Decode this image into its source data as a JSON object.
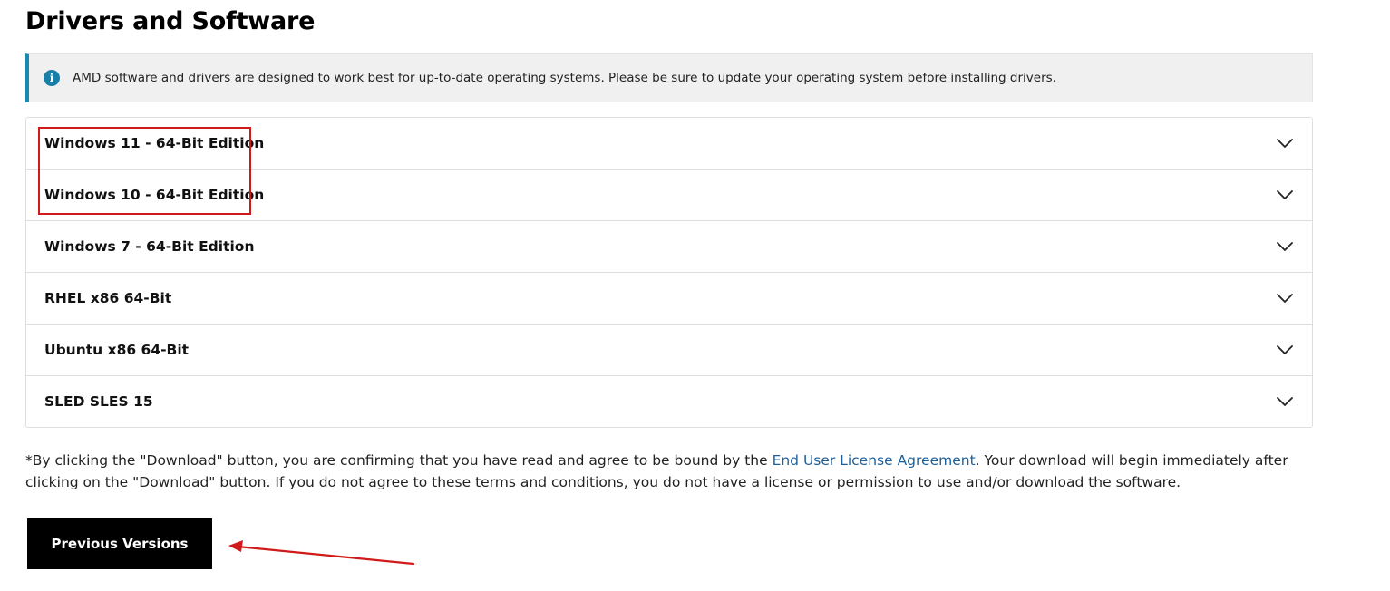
{
  "page": {
    "title": "Drivers and Software"
  },
  "notice": {
    "icon": "info-icon",
    "icon_glyph": "i",
    "text": "AMD software and drivers are designed to work best for up-to-date operating systems. Please be sure to update your operating system before installing drivers."
  },
  "accordion": {
    "items": [
      {
        "label": "Windows 11 - 64-Bit Edition",
        "icon": "chevron-down-icon"
      },
      {
        "label": "Windows 10 - 64-Bit Edition",
        "icon": "chevron-down-icon"
      },
      {
        "label": "Windows 7 - 64-Bit Edition",
        "icon": "chevron-down-icon"
      },
      {
        "label": "RHEL x86 64-Bit",
        "icon": "chevron-down-icon"
      },
      {
        "label": "Ubuntu x86 64-Bit",
        "icon": "chevron-down-icon"
      },
      {
        "label": "SLED SLES 15",
        "icon": "chevron-down-icon"
      }
    ]
  },
  "disclaimer": {
    "before_link": "*By clicking the \"Download\" button, you are confirming that you have read and agree to be bound by the ",
    "link_text": "End User License Agreement",
    "after_link": ". Your download will begin immediately after clicking on the \"Download\" button. If you do not agree to these terms and conditions, you do not have a license or permission to use and/or download the software."
  },
  "previous_versions": {
    "label": "Previous Versions"
  },
  "annotations": {
    "color": "#d11a1a",
    "highlight_box": "windows-11-and-10-rows",
    "arrow_target": "previous-versions-button"
  },
  "colors": {
    "notice_accent": "#1a8ab0",
    "link": "#1d5f9b",
    "button_bg": "#000000"
  }
}
